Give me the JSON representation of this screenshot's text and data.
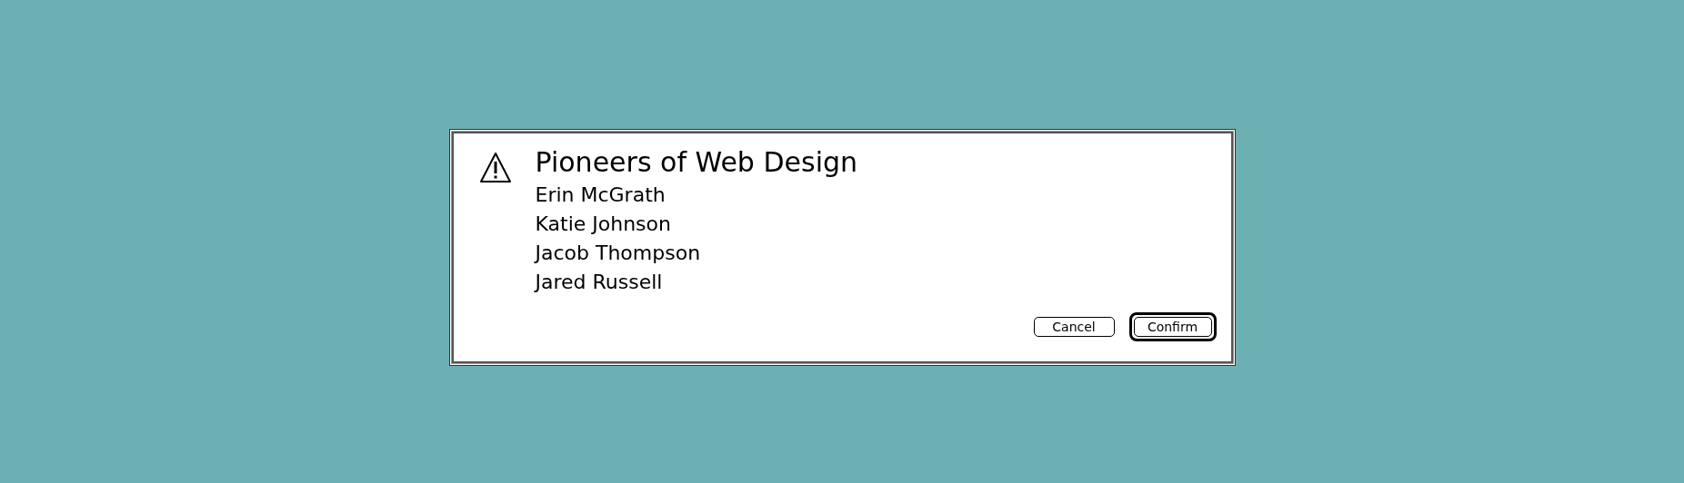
{
  "dialog": {
    "kind": "warning",
    "title": "Pioneers of Web Design",
    "items": [
      "Erin McGrath",
      "Katie Johnson",
      "Jacob Thompson",
      "Jared Russell"
    ],
    "buttons": [
      {
        "label": "Cancel",
        "default": false
      },
      {
        "label": "Confirm",
        "default": true
      }
    ]
  }
}
